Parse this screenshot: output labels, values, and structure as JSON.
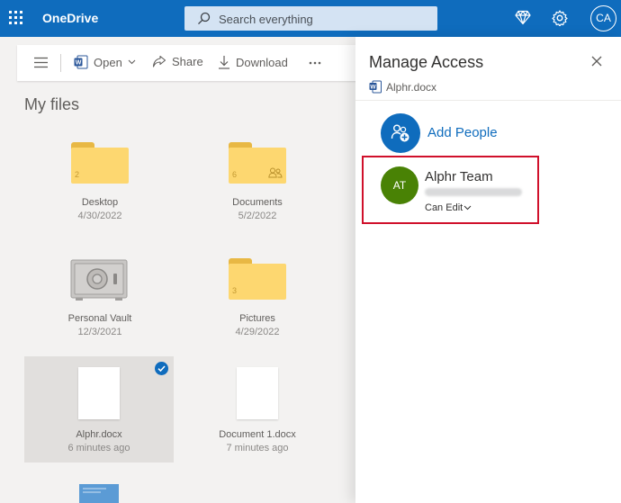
{
  "app": {
    "title": "OneDrive",
    "user_initials": "CA"
  },
  "search": {
    "placeholder": "Search everything"
  },
  "toolbar": {
    "open_label": "Open",
    "share_label": "Share",
    "download_label": "Download"
  },
  "main": {
    "heading": "My files"
  },
  "files": [
    {
      "name": "Desktop",
      "date": "4/30/2022",
      "type": "folder",
      "count": "2",
      "shared": false
    },
    {
      "name": "Documents",
      "date": "5/2/2022",
      "type": "folder",
      "count": "6",
      "shared": true
    },
    {
      "name": "Personal Vault",
      "date": "12/3/2021",
      "type": "vault"
    },
    {
      "name": "Pictures",
      "date": "4/29/2022",
      "type": "folder",
      "count": "3",
      "shared": false
    },
    {
      "name": "Alphr.docx",
      "date": "6 minutes ago",
      "type": "doc",
      "selected": true
    },
    {
      "name": "Document 1.docx",
      "date": "7 minutes ago",
      "type": "doc",
      "selected": false
    }
  ],
  "panel": {
    "title": "Manage Access",
    "file_name": "Alphr.docx",
    "add_people_label": "Add People",
    "person": {
      "initials": "AT",
      "name": "Alphr Team",
      "permission": "Can Edit"
    }
  },
  "colors": {
    "brand": "#0f6cbd",
    "avatar_green": "#498205",
    "highlight_red": "#d0102b",
    "folder": "#fdd770"
  }
}
